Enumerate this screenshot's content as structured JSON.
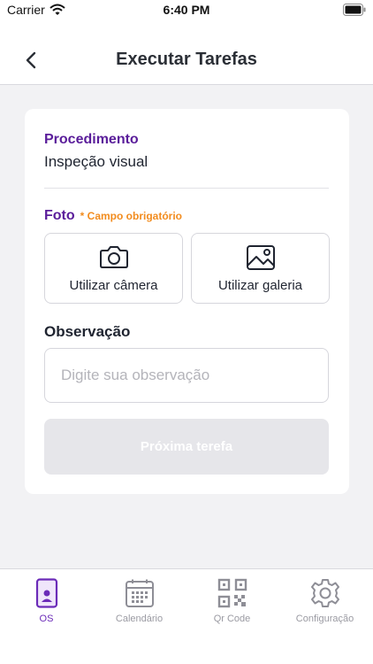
{
  "status_bar": {
    "carrier": "Carrier",
    "time": "6:40 PM"
  },
  "header": {
    "title": "Executar Tarefas",
    "back_icon": "chevron-left-icon"
  },
  "form": {
    "procedure_label": "Procedimento",
    "procedure_value": "Inspeção visual",
    "photo_label": "Foto",
    "photo_required": "* Campo obrigatório",
    "camera_button": "Utilizar câmera",
    "gallery_button": "Utilizar galeria",
    "observation_label": "Observação",
    "observation_placeholder": "Digite sua observação",
    "observation_value": "",
    "next_button": "Próxima terefa"
  },
  "tabs": [
    {
      "label": "OS",
      "icon": "device-user-icon",
      "active": true
    },
    {
      "label": "Calendário",
      "icon": "calendar-icon",
      "active": false
    },
    {
      "label": "Qr Code",
      "icon": "qr-code-icon",
      "active": false
    },
    {
      "label": "Configuração",
      "icon": "gear-icon",
      "active": false
    }
  ],
  "colors": {
    "accent": "#5a1d9a",
    "required": "#f28c1e",
    "disabled_button": "#e6e6ea",
    "background": "#f2f2f4"
  }
}
